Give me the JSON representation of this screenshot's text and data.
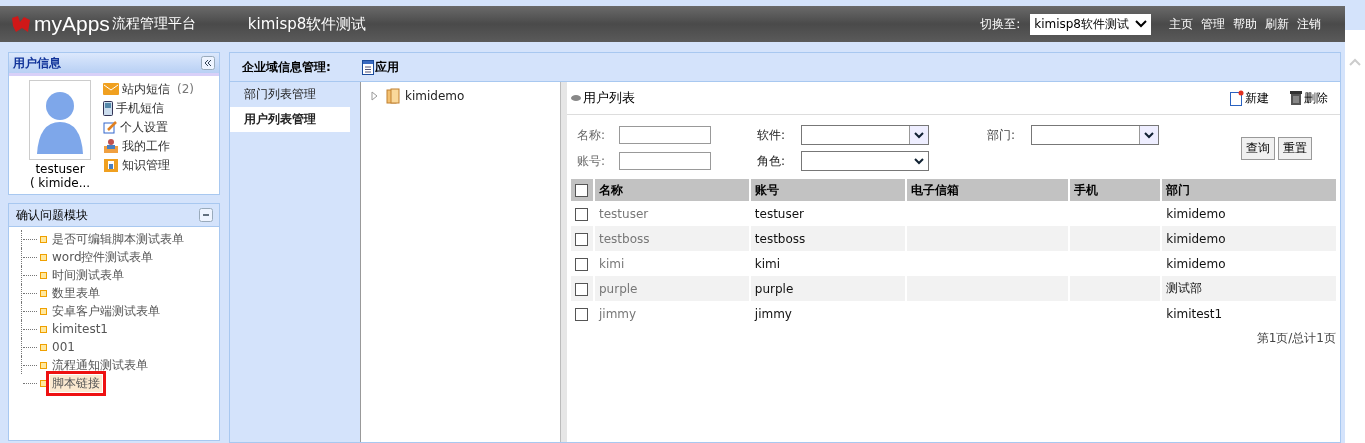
{
  "header": {
    "logo": "myApps",
    "platform": "流程管理平台",
    "app_title": "kimisp8软件测试",
    "switch_label": "切换至:",
    "switch_value": "kimisp8软件测试",
    "links": [
      "主页",
      "管理",
      "帮助",
      "刷新",
      "注销"
    ]
  },
  "user_panel": {
    "title": "用户信息",
    "username": "testuser",
    "domain": "( kimide...",
    "links": [
      {
        "kind": "mail",
        "label": "站内短信",
        "count": "(2)"
      },
      {
        "kind": "phone",
        "label": "手机短信"
      },
      {
        "kind": "edit",
        "label": "个人设置"
      },
      {
        "kind": "work",
        "label": "我的工作"
      },
      {
        "kind": "knowledge",
        "label": "知识管理"
      }
    ]
  },
  "module_panel": {
    "title": "确认问题模块",
    "items": [
      {
        "label": "是否可编辑脚本测试表单",
        "selected": false
      },
      {
        "label": "word控件测试表单",
        "selected": false
      },
      {
        "label": "时间测试表单",
        "selected": false
      },
      {
        "label": "数里表单",
        "selected": false
      },
      {
        "label": "安卓客户端测试表单",
        "selected": false
      },
      {
        "label": "kimitest1",
        "selected": false
      },
      {
        "label": "001",
        "selected": false
      },
      {
        "label": "流程通知测试表单",
        "selected": false
      },
      {
        "label": "脚本链接",
        "selected": true
      }
    ]
  },
  "main": {
    "title": "企业域信息管理:",
    "apply": "应用",
    "nav": [
      {
        "label": "部门列表管理",
        "selected": false
      },
      {
        "label": "用户列表管理",
        "selected": true
      }
    ],
    "tree": {
      "root": "kimidemo"
    },
    "user_list": {
      "title": "用户列表",
      "new": "新建",
      "delete": "删除",
      "filters": {
        "name_label": "名称:",
        "software_label": "软件:",
        "department_label": "部门:",
        "account_label": "账号:",
        "role_label": "角色:"
      },
      "query": "查询",
      "reset": "重置",
      "select_all_checked": false,
      "columns": [
        "名称",
        "账号",
        "电子信箱",
        "手机",
        "部门"
      ],
      "rows": [
        {
          "checked": false,
          "cells": [
            "testuser",
            "testuser",
            "",
            "",
            "kimidemo"
          ]
        },
        {
          "checked": false,
          "cells": [
            "testboss",
            "testboss",
            "",
            "",
            "kimidemo"
          ]
        },
        {
          "checked": false,
          "cells": [
            "kimi",
            "kimi",
            "",
            "",
            "kimidemo"
          ]
        },
        {
          "checked": false,
          "cells": [
            "purple",
            "purple",
            "",
            "",
            "测试部"
          ]
        },
        {
          "checked": false,
          "cells": [
            "jimmy",
            "jimmy",
            "",
            "",
            "kimitest1"
          ]
        }
      ],
      "pagination": "第1页/总计1页"
    }
  }
}
